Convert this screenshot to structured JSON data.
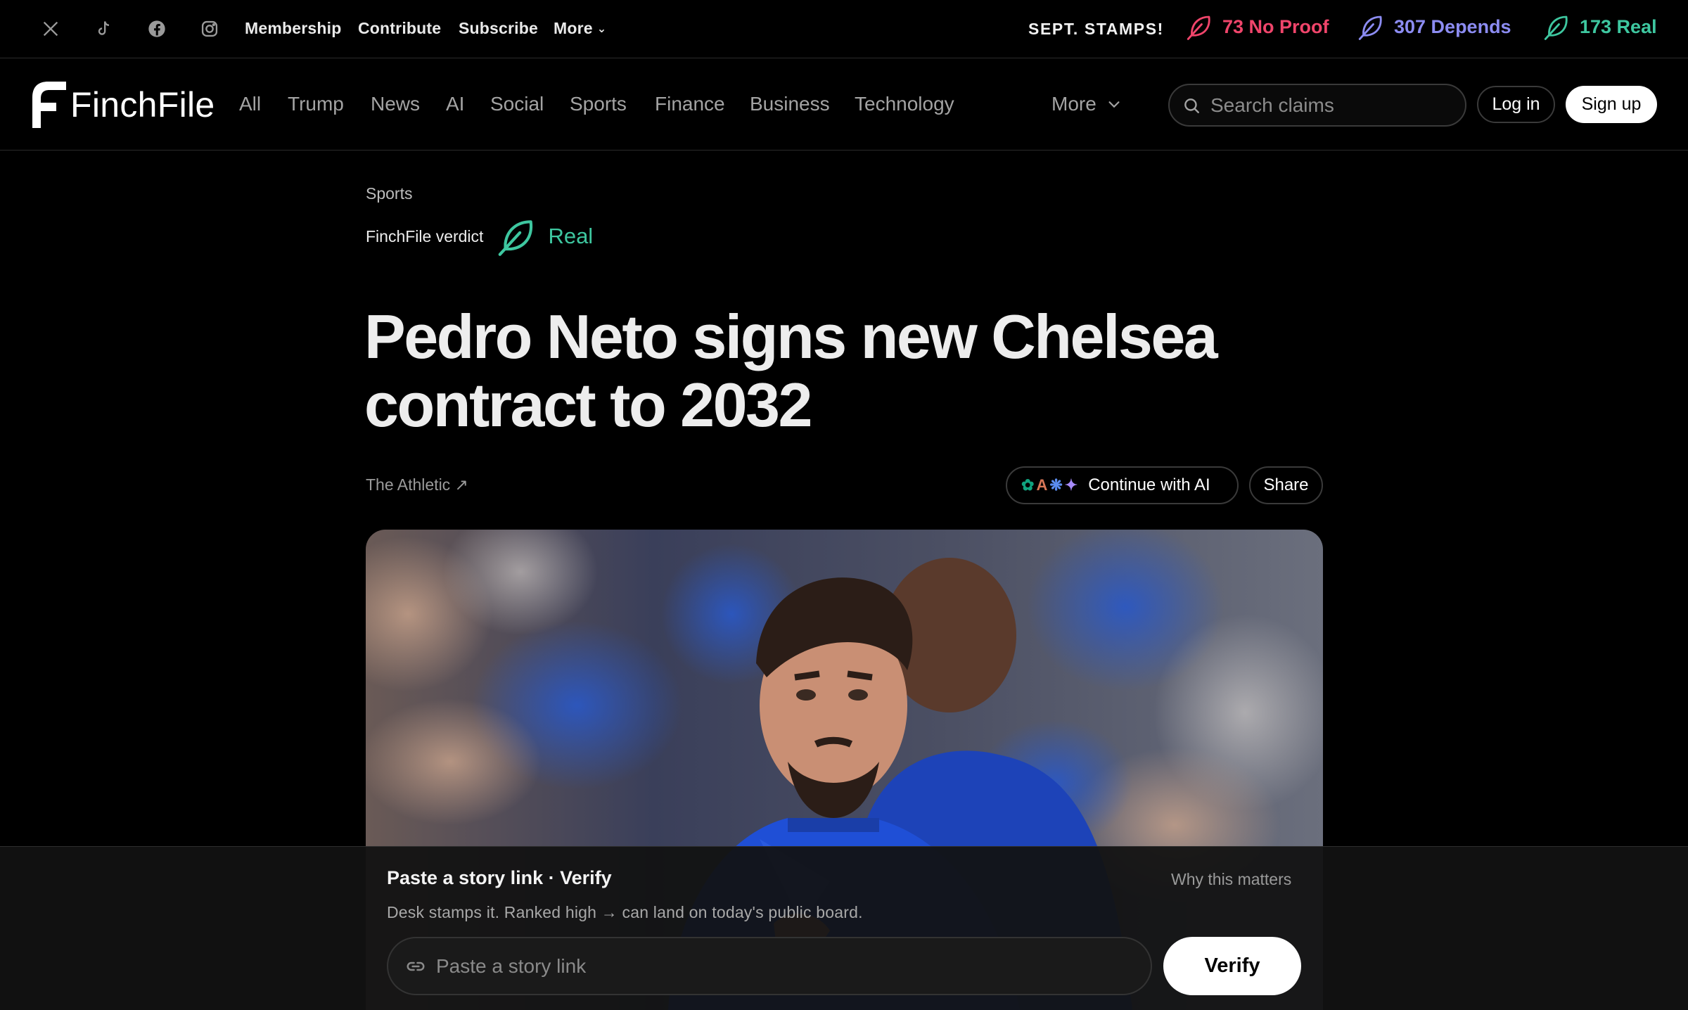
{
  "topbar": {
    "social_icons": [
      "x-icon",
      "tiktok-icon",
      "facebook-icon",
      "instagram-icon"
    ],
    "links": [
      "Membership",
      "Contribute",
      "Subscribe"
    ],
    "more_label": "More",
    "stamps_title": "SEPT. STAMPS!",
    "stamps": [
      {
        "label": "73 No Proof",
        "color": "#f0456b",
        "icon": "feather-icon"
      },
      {
        "label": "307 Depends",
        "color": "#8c8cf2",
        "icon": "feather-icon"
      },
      {
        "label": "173 Real",
        "color": "#3ec7a0",
        "icon": "feather-icon"
      }
    ]
  },
  "nav": {
    "logo_text": "FinchFile",
    "items": [
      "All",
      "Trump",
      "News",
      "AI",
      "Social",
      "Sports",
      "Finance",
      "Business",
      "Technology"
    ],
    "more_label": "More",
    "search_placeholder": "Search claims",
    "login_label": "Log in",
    "signup_label": "Sign up"
  },
  "article": {
    "category": "Sports",
    "verdict_label": "FinchFile verdict",
    "verdict_value": "Real",
    "verdict_color": "#3ec7a0",
    "title": "Pedro Neto signs new Chelsea contract to 2032",
    "source": "The Athletic ↗",
    "ai_button_label": "Continue with AI",
    "share_label": "Share",
    "hero_image": "football-players-celebrating-photo"
  },
  "verify_panel": {
    "title": "Paste a story link · Verify",
    "why_label": "Why this matters",
    "subtitle": "Desk stamps it. Ranked high → can land on today's public board.",
    "input_placeholder": "Paste a story link",
    "verify_label": "Verify"
  }
}
